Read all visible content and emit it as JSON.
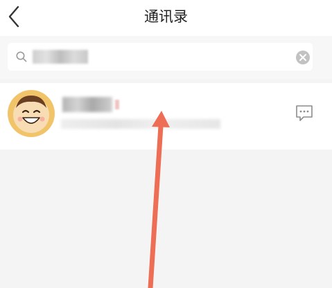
{
  "navbar": {
    "title": "通讯录",
    "back_icon": "chevron-left-icon"
  },
  "search": {
    "icon": "search-icon",
    "value": "",
    "clear_icon": "clear-icon"
  },
  "contact": {
    "name": "",
    "description": "",
    "avatar_icon": "smiley-avatar-icon",
    "message_icon": "message-bubble-icon"
  },
  "annotation": {
    "arrow_color": "#ee6d55"
  }
}
